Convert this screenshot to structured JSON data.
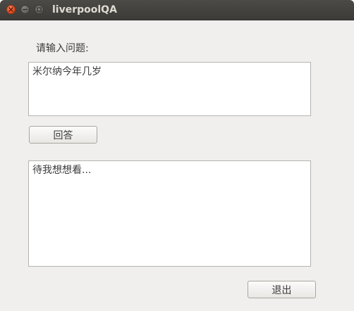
{
  "window": {
    "title": "liverpoolQA"
  },
  "form": {
    "prompt_label": "请输入问题:",
    "question_value": "米尔纳今年几岁",
    "answer_button_label": "回答",
    "answer_text": "待我想想看...",
    "exit_button_label": "退出"
  },
  "icons": {
    "close": "close-icon",
    "minimize": "minimize-icon",
    "maximize": "maximize-icon"
  },
  "colors": {
    "close_button": "#e0461c",
    "titlebar": "#3c3b37",
    "window_bg": "#f0efed"
  }
}
